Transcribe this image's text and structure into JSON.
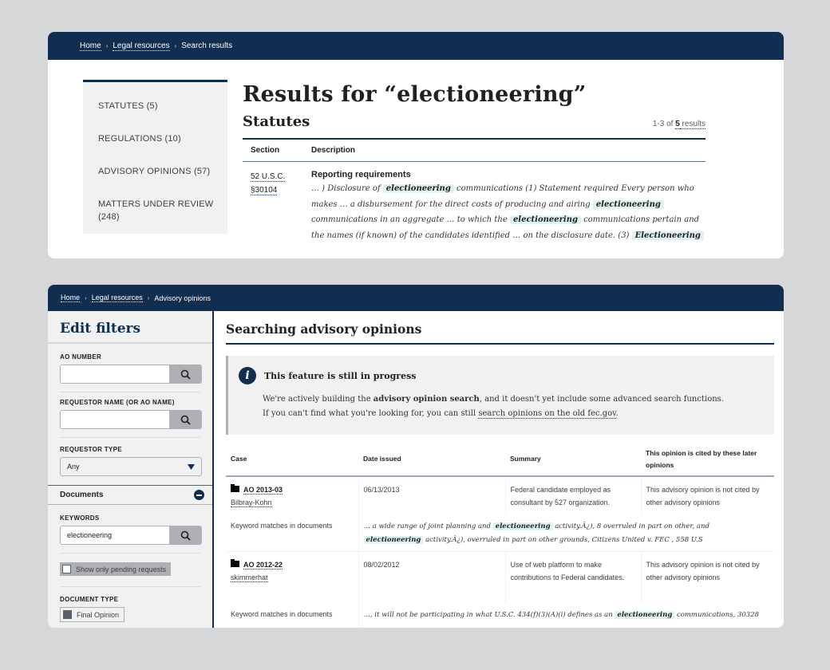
{
  "panel1": {
    "breadcrumb": {
      "home": "Home",
      "legal": "Legal resources",
      "current": "Search results"
    },
    "sidebar": [
      {
        "label": "STATUTES (5)"
      },
      {
        "label": "REGULATIONS (10)"
      },
      {
        "label": "ADVISORY OPINIONS (57)"
      },
      {
        "label": "MATTERS UNDER REVIEW (248)"
      }
    ],
    "title": "Results for “electioneering”",
    "section_title": "Statutes",
    "count": {
      "range": "1-3 of ",
      "total": "5",
      "suffix": " results"
    },
    "table": {
      "headers": {
        "section": "Section",
        "description": "Description"
      },
      "rows": [
        {
          "section_line1": "52 U.S.C.",
          "section_line2": "§30104",
          "title": "Reporting requirements",
          "snippet": [
            {
              "t": "… ) Disclosure of "
            },
            {
              "m": "electioneering"
            },
            {
              "t": " communications (1) Statement required Every person who makes … a disbursement for the direct costs of producing and airing "
            },
            {
              "m": "electioneering"
            },
            {
              "t": " communications in an aggregate … to which the "
            },
            {
              "m": "electioneering"
            },
            {
              "t": " communications pertain and the names (if known) of the candidates identified … on the disclosure date. (3) "
            },
            {
              "m": "Electioneering"
            }
          ]
        }
      ]
    }
  },
  "panel2": {
    "breadcrumb": {
      "home": "Home",
      "legal": "Legal resources",
      "current": "Advisory opinions"
    },
    "filters": {
      "title": "Edit filters",
      "ao_number_label": "AO NUMBER",
      "ao_number_value": "",
      "requestor_name_label": "REQUESTOR NAME (OR AO NAME)",
      "requestor_name_value": "",
      "requestor_type_label": "REQUESTOR TYPE",
      "requestor_type_value": "Any",
      "documents_label": "Documents",
      "keywords_label": "KEYWORDS",
      "keywords_value": "electioneering",
      "pending_label": "Show only pending requests",
      "document_type_label": "DOCUMENT TYPE",
      "document_type_first": "Final Opinion"
    },
    "title": "Searching advisory opinions",
    "notice": {
      "heading": "This feature is still in progress",
      "line1_pre": "We're actively building the ",
      "line1_bold": "advisory opinion search",
      "line1_post": ", and it doesn't yet include some advanced search functions.",
      "line2_pre": "If you can't find what you're looking for, you can still ",
      "line2_link": "search opinions on the old fec.gov",
      "line2_post": "."
    },
    "table": {
      "headers": {
        "case": "Case",
        "date": "Date issued",
        "summary": "Summary",
        "cited": "This opinion is cited by these later opinions"
      },
      "keyword_label": "Keyword matches in documents",
      "rows": [
        {
          "number": "AO 2013-03",
          "name": "Bilbray-Kohn",
          "date": "06/13/2013",
          "summary": "Federal candidate employed as consultant by 527 organization.",
          "cited": "This advisory opinion is not cited by other advisory opinions",
          "snippet": [
            {
              "t": "… a wide range of joint planning and "
            },
            {
              "m": "electioneering"
            },
            {
              "t": " activity.Â¿), 8 overruled in part on other, and "
            },
            {
              "m": "electioneering"
            },
            {
              "t": " activity.Â¿), overruled in part on other grounds, Citizens United v. FEC , 558 U.S"
            }
          ]
        },
        {
          "number": "AO 2012-22",
          "name": "skimmerhat",
          "date": "08/02/2012",
          "summary": "Use of web platform to make contributions to Federal candidates.",
          "cited": "This advisory opinion is not cited by other advisory opinions",
          "snippet": [
            {
              "t": "…, it will not be participating in what U.S.C. 434(f)(3)(A)(i) defines as an "
            },
            {
              "m": "electioneering"
            },
            {
              "t": " communications, 30328"
            }
          ]
        }
      ]
    }
  },
  "colors": {
    "navy": "#112e51",
    "highlight": "#dff4f2",
    "sidebar_bg": "#f1f1f1",
    "page_bg": "#d6d7d9"
  }
}
